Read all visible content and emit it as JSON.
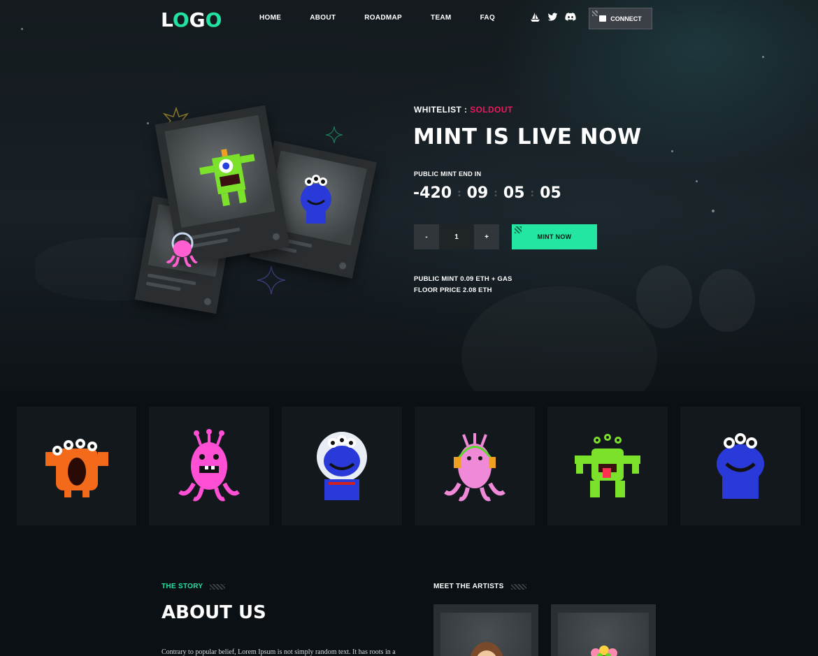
{
  "nav": {
    "logo_first": "L",
    "logo_o1": "O",
    "logo_g": "G",
    "logo_o2": "O",
    "menu": [
      "HOME",
      "ABOUT",
      "ROADMAP",
      "TEAM",
      "FAQ"
    ],
    "social_icons": [
      "opensea-boat-icon",
      "twitter-icon",
      "discord-icon"
    ],
    "connect_label": "CONNECT"
  },
  "hero": {
    "whitelist_label": "WHITELIST :",
    "whitelist_status": "SOLDOUT",
    "title": "MINT IS LIVE NOW",
    "countdown_label": "PUBLIC MINT END IN",
    "countdown": [
      "-420",
      "09",
      "05",
      "05"
    ],
    "quantity": {
      "minus": "-",
      "value": "1",
      "plus": "+"
    },
    "mint_button": "MINT NOW",
    "public_mint": "PUBLIC MINT 0.09 ETH + GAS",
    "floor_price": "FLOOR PRICE 2.08 ETH"
  },
  "gallery": {
    "items": [
      "orange-monster",
      "pink-monster",
      "astronaut-blue-monster",
      "pink-headphone-monster",
      "green-monster",
      "blue-monster"
    ]
  },
  "about": {
    "eyebrow": "THE STORY",
    "title": "ABOUT US",
    "text": "Contrary to popular belief, Lorem Ipsum is not simply random text. It has roots in a"
  },
  "artists": {
    "heading": "MEET THE ARTISTS"
  },
  "colors": {
    "accent": "#21e2a0",
    "soldout": "#e9185d",
    "background": "#0b1014"
  }
}
